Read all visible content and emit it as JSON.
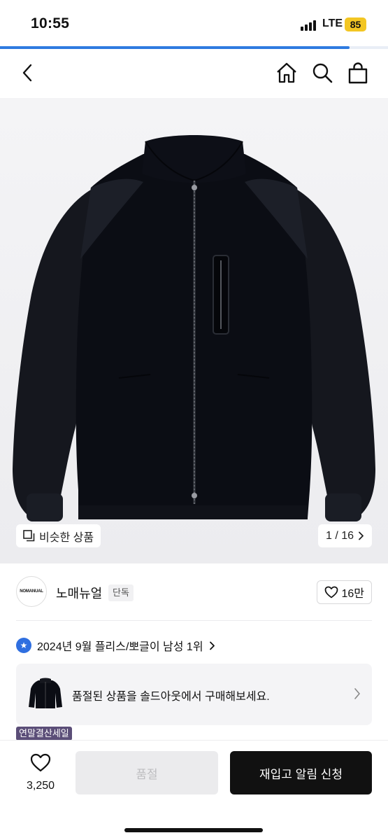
{
  "status_bar": {
    "time": "10:55",
    "network": "LTE",
    "battery": "85"
  },
  "browse_progress": {
    "fraction": 0.9
  },
  "nav": {
    "back_icon": "chevron-left-icon",
    "home_icon": "home-icon",
    "search_icon": "search-icon",
    "cart_icon": "shopping-bag-icon"
  },
  "product_image": {
    "similar_label": "비슷한 상품",
    "pager": "1 / 16"
  },
  "brand": {
    "logo_text": "NOMANUAL",
    "name": "노매뉴얼",
    "badge": "단독",
    "likes": "16만"
  },
  "ranking": {
    "text": "2024년 9월 플리스/뽀글이 남성 1위"
  },
  "soldout_card": {
    "text": "품절된 상품을 솔드아웃에서 구매해보세요."
  },
  "sale_badge": "연말결산세일",
  "bottom_bar": {
    "wish_count": "3,250",
    "soldout_label": "품절",
    "restock_label": "재입고 알림 신청"
  },
  "colors": {
    "accent": "#2e7be0",
    "cta": "#111111",
    "sale_badge": "#5b4e78"
  }
}
